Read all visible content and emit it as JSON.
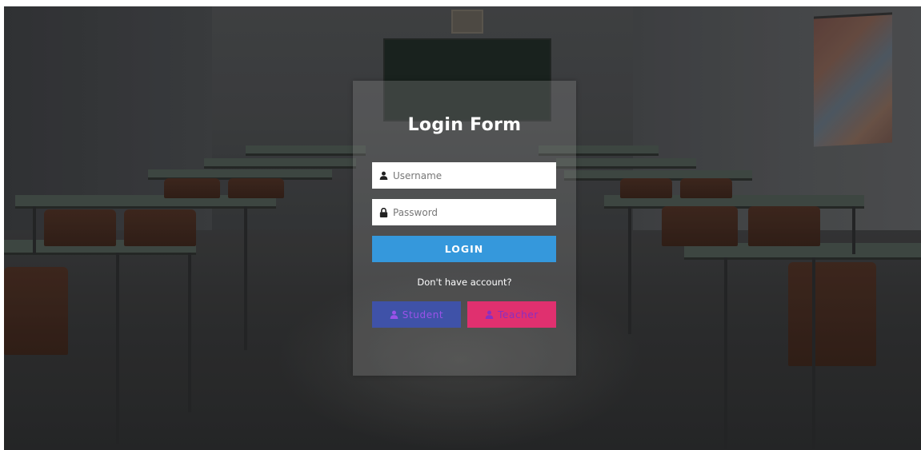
{
  "login": {
    "title": "Login Form",
    "username_placeholder": "Username",
    "password_placeholder": "Password",
    "login_label": "LOGIN",
    "no_account_text": "Don't have account?",
    "student_label": "Student",
    "teacher_label": "Teacher"
  },
  "icons": {
    "username": "user-icon",
    "password": "lock-icon",
    "student": "user-icon",
    "teacher": "user-icon"
  },
  "colors": {
    "login_button": "#3598dc",
    "student_button": "#3f52a8",
    "teacher_button": "#e0306f",
    "panel": "rgba(150,150,150,0.28)"
  }
}
